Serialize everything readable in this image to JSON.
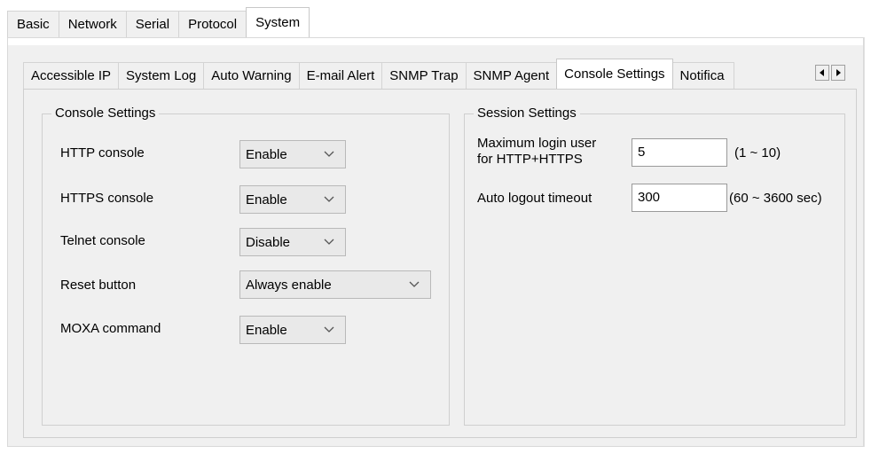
{
  "top_tabs": [
    {
      "label": "Basic"
    },
    {
      "label": "Network"
    },
    {
      "label": "Serial"
    },
    {
      "label": "Protocol"
    },
    {
      "label": "System"
    }
  ],
  "active_top_tab": "System",
  "sub_tabs": [
    {
      "label": "Accessible IP"
    },
    {
      "label": "System Log"
    },
    {
      "label": "Auto Warning"
    },
    {
      "label": "E-mail Alert"
    },
    {
      "label": "SNMP Trap"
    },
    {
      "label": "SNMP Agent"
    },
    {
      "label": "Console Settings"
    },
    {
      "label": "Notifica"
    }
  ],
  "active_sub_tab": "Console Settings",
  "scroll": {
    "left_icon": "arrow-left-icon",
    "right_icon": "arrow-right-icon"
  },
  "console_settings": {
    "title": "Console Settings",
    "rows": [
      {
        "label": "HTTP console",
        "value": "Enable"
      },
      {
        "label": "HTTPS console",
        "value": "Enable"
      },
      {
        "label": "Telnet console",
        "value": "Disable"
      },
      {
        "label": "Reset button",
        "value": "Always enable"
      },
      {
        "label": "MOXA command",
        "value": "Enable"
      }
    ]
  },
  "session_settings": {
    "title": "Session Settings",
    "max_login": {
      "label_line1": "Maximum login user",
      "label_line2": "for HTTP+HTTPS",
      "value": "5",
      "hint": "(1 ~ 10)"
    },
    "auto_logout": {
      "label": "Auto logout timeout",
      "value": "300",
      "hint": "(60 ~ 3600 sec)"
    }
  }
}
